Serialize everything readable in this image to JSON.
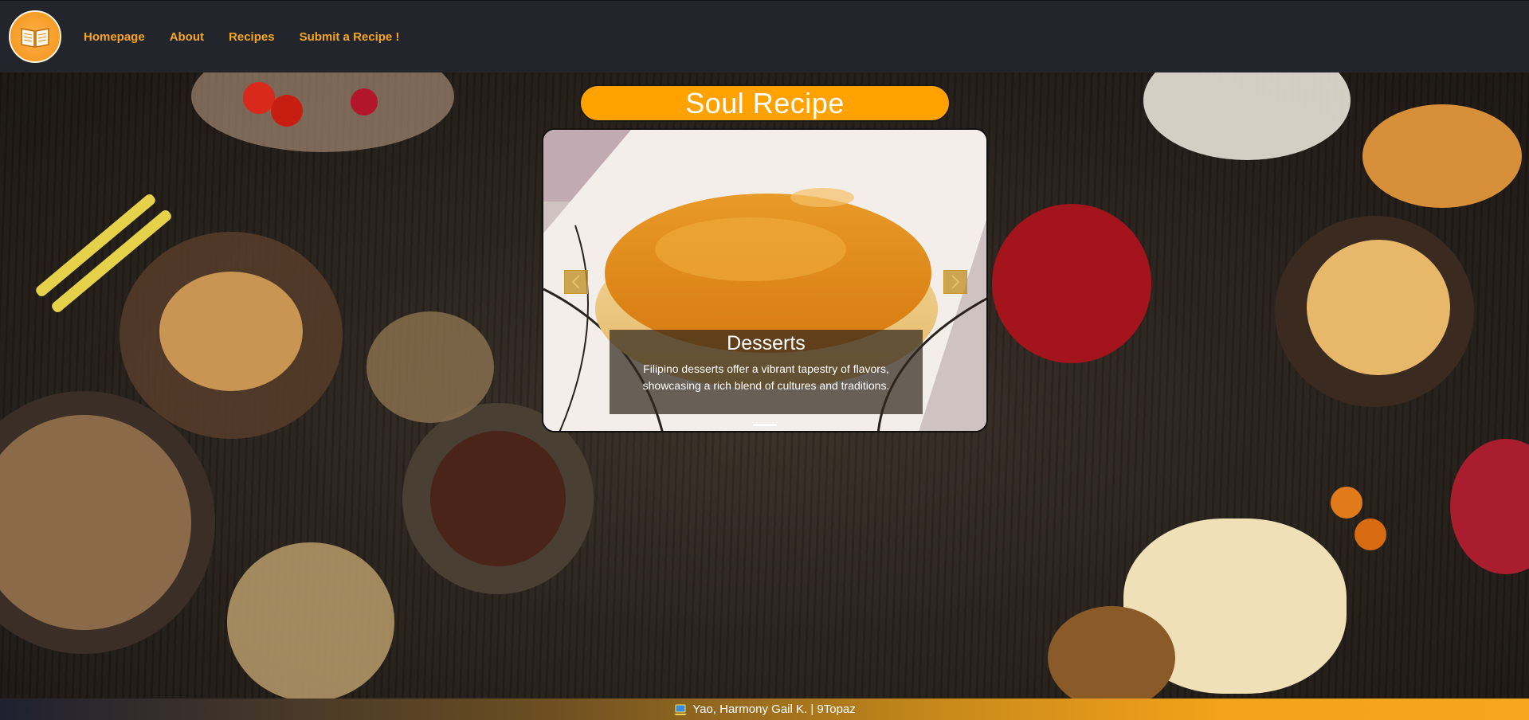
{
  "nav": {
    "logo_icon": "book-icon",
    "links": [
      "Homepage",
      "About",
      "Recipes",
      "Submit a Recipe !"
    ]
  },
  "hero": {
    "title": "Soul Recipe",
    "accent_color": "#ffa200"
  },
  "carousel": {
    "prev_icon": "chevron-left-icon",
    "next_icon": "chevron-right-icon",
    "slide": {
      "title": "Desserts",
      "description": "Filipino desserts offer a vibrant tapestry of flavors, showcasing a rich blend of cultures and traditions."
    },
    "indicators": 1
  },
  "footer": {
    "icon": "laptop-icon",
    "text": "Yao, Harmony Gail K. | 9Topaz"
  }
}
